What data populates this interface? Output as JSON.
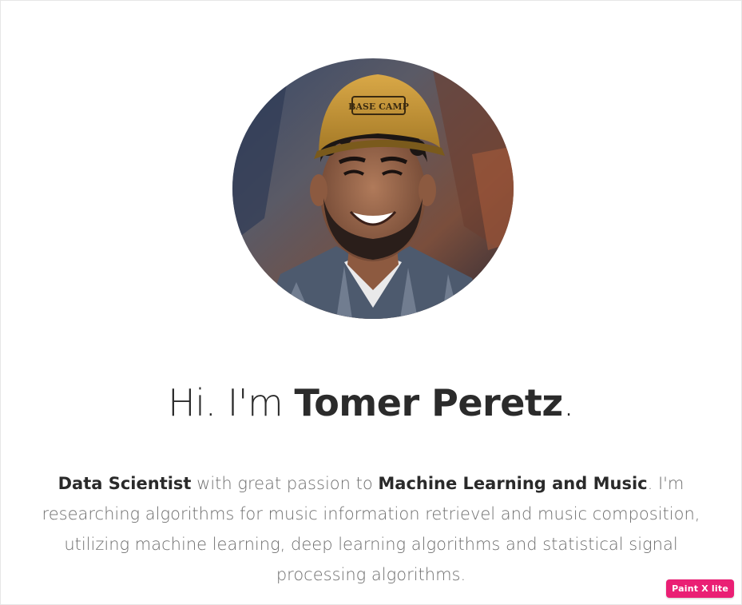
{
  "profile": {
    "avatar_alt": "profile photo",
    "greeting_prefix": "Hi. I'm",
    "name": "Tomer Peretz",
    "greeting_suffix": "."
  },
  "bio": {
    "role": "Data Scientist",
    "text_1": " with great passion to ",
    "focus": "Machine Learning and Music",
    "text_2": ". I'm researching algorithms for music information retrievel and music composition, utilizing machine learning, deep learning algorithms and statistical signal processing algorithms."
  },
  "badge": {
    "label": "Paint X lite"
  },
  "colors": {
    "heading": "#2b2b2b",
    "body": "#6f6f6f",
    "badge_bg": "#ea1f74"
  }
}
